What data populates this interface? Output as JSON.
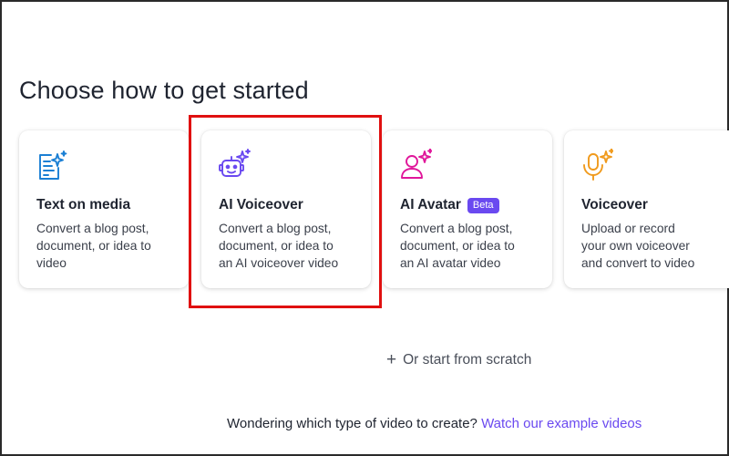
{
  "page_title": "Choose how to get started",
  "cards": [
    {
      "icon": "document-sparkle-icon",
      "title": "Text on media",
      "description": "Convert a blog post,\ndocument, or idea to\nvideo"
    },
    {
      "icon": "robot-face-sparkle-icon",
      "title": "AI Voiceover",
      "description": "Convert a blog post,\ndocument, or idea to\nan AI voiceover video"
    },
    {
      "icon": "person-sparkle-icon",
      "title": "AI Avatar",
      "badge": "Beta",
      "description": "Convert a blog post,\ndocument, or idea to\nan AI avatar video"
    },
    {
      "icon": "microphone-sparkle-icon",
      "title": "Voiceover",
      "description": "Upload or record\nyour own voiceover\nand convert to video"
    }
  ],
  "start_from_scratch": "Or start from scratch",
  "footer": {
    "question": "Wondering which type of video to create?",
    "link": "Watch our example videos"
  },
  "colors": {
    "accent": "#6a49f0",
    "text_icon": "#1a7fd4",
    "voiceover_ai_icon": "#6a49f0",
    "avatar_icon": "#e0169a",
    "mic_icon": "#f09a1c",
    "highlight": "#e01010"
  }
}
